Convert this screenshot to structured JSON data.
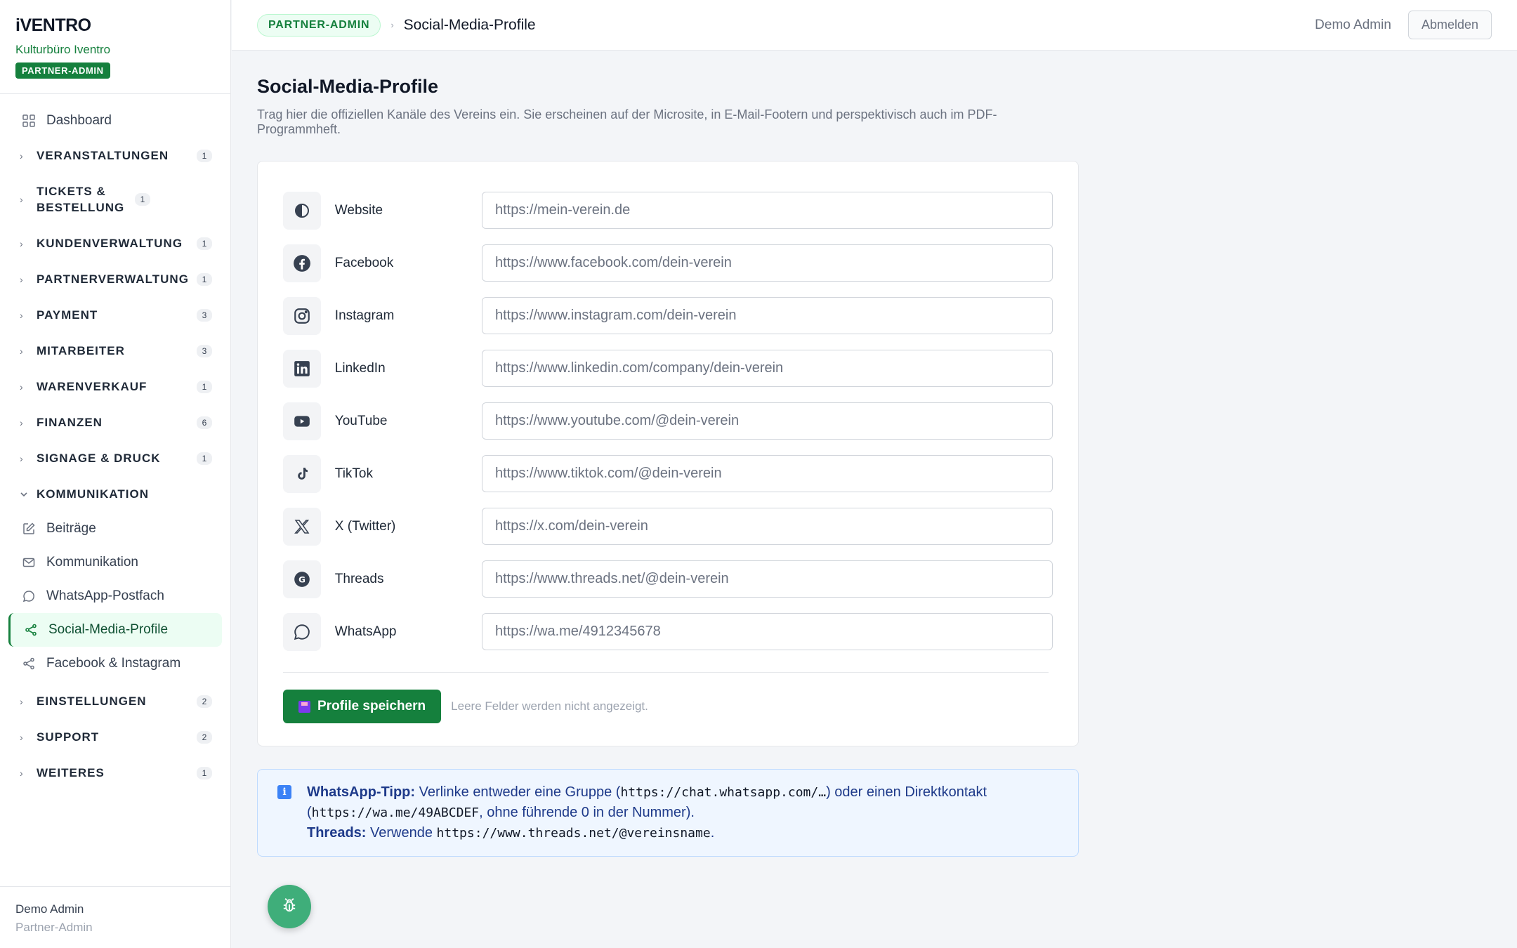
{
  "brand": {
    "logo": "iVENTRO",
    "org": "Kulturbüro Iventro",
    "badge": "PARTNER-ADMIN"
  },
  "nav": {
    "dashboard": "Dashboard",
    "sections": [
      {
        "label": "VERANSTALTUNGEN",
        "count": "1"
      },
      {
        "label": "TICKETS & BESTELLUNG",
        "count": "1"
      },
      {
        "label": "KUNDENVERWALTUNG",
        "count": "1"
      },
      {
        "label": "PARTNERVERWALTUNG",
        "count": "1"
      },
      {
        "label": "PAYMENT",
        "count": "3"
      },
      {
        "label": "MITARBEITER",
        "count": "3"
      },
      {
        "label": "WARENVERKAUF",
        "count": "1"
      },
      {
        "label": "FINANZEN",
        "count": "6"
      },
      {
        "label": "SIGNAGE & DRUCK",
        "count": "1"
      }
    ],
    "open_section": "KOMMUNIKATION",
    "sub_items": [
      "Beiträge",
      "Kommunikation",
      "WhatsApp-Postfach",
      "Social-Media-Profile",
      "Facebook & Instagram"
    ],
    "after_sections": [
      {
        "label": "EINSTELLUNGEN",
        "count": "2"
      },
      {
        "label": "SUPPORT",
        "count": "2"
      },
      {
        "label": "WEITERES",
        "count": "1"
      }
    ]
  },
  "sidebar_footer": {
    "user": "Demo Admin",
    "role": "Partner-Admin"
  },
  "topbar": {
    "badge": "PARTNER-ADMIN",
    "separator": "›",
    "title": "Social-Media-Profile",
    "user": "Demo Admin",
    "logout": "Abmelden"
  },
  "page": {
    "title": "Social-Media-Profile",
    "description": "Trag hier die offiziellen Kanäle des Vereins ein. Sie erscheinen auf der Microsite, in E-Mail-Footern und perspektivisch auch im PDF-Programmheft."
  },
  "profiles": [
    {
      "label": "Website",
      "icon": "website-icon",
      "placeholder": "https://mein-verein.de"
    },
    {
      "label": "Facebook",
      "icon": "facebook-icon",
      "placeholder": "https://www.facebook.com/dein-verein"
    },
    {
      "label": "Instagram",
      "icon": "instagram-icon",
      "placeholder": "https://www.instagram.com/dein-verein"
    },
    {
      "label": "LinkedIn",
      "icon": "linkedin-icon",
      "placeholder": "https://www.linkedin.com/company/dein-verein"
    },
    {
      "label": "YouTube",
      "icon": "youtube-icon",
      "placeholder": "https://www.youtube.com/@dein-verein"
    },
    {
      "label": "TikTok",
      "icon": "tiktok-icon",
      "placeholder": "https://www.tiktok.com/@dein-verein"
    },
    {
      "label": "X (Twitter)",
      "icon": "x-icon",
      "placeholder": "https://x.com/dein-verein"
    },
    {
      "label": "Threads",
      "icon": "threads-icon",
      "placeholder": "https://www.threads.net/@dein-verein"
    },
    {
      "label": "WhatsApp",
      "icon": "whatsapp-icon",
      "placeholder": "https://wa.me/4912345678"
    }
  ],
  "actions": {
    "save": "Profile speichern",
    "hint": "Leere Felder werden nicht angezeigt."
  },
  "tip": {
    "wa_title": "WhatsApp-Tipp:",
    "wa_text1": " Verlinke entweder eine Gruppe (",
    "wa_code1": "https://chat.whatsapp.com/…",
    "wa_text2": ") oder einen Direktkontakt (",
    "wa_code2": "https://wa.me/49ABCDEF",
    "wa_text3": ", ohne führende 0 in der Nummer).",
    "th_title": "Threads:",
    "th_text": " Verwende ",
    "th_code": "https://www.threads.net/@vereinsname",
    "th_end": "."
  },
  "colors": {
    "accent": "#15803d",
    "active_bg": "#ecfdf3",
    "tip_bg": "#eff6ff"
  }
}
